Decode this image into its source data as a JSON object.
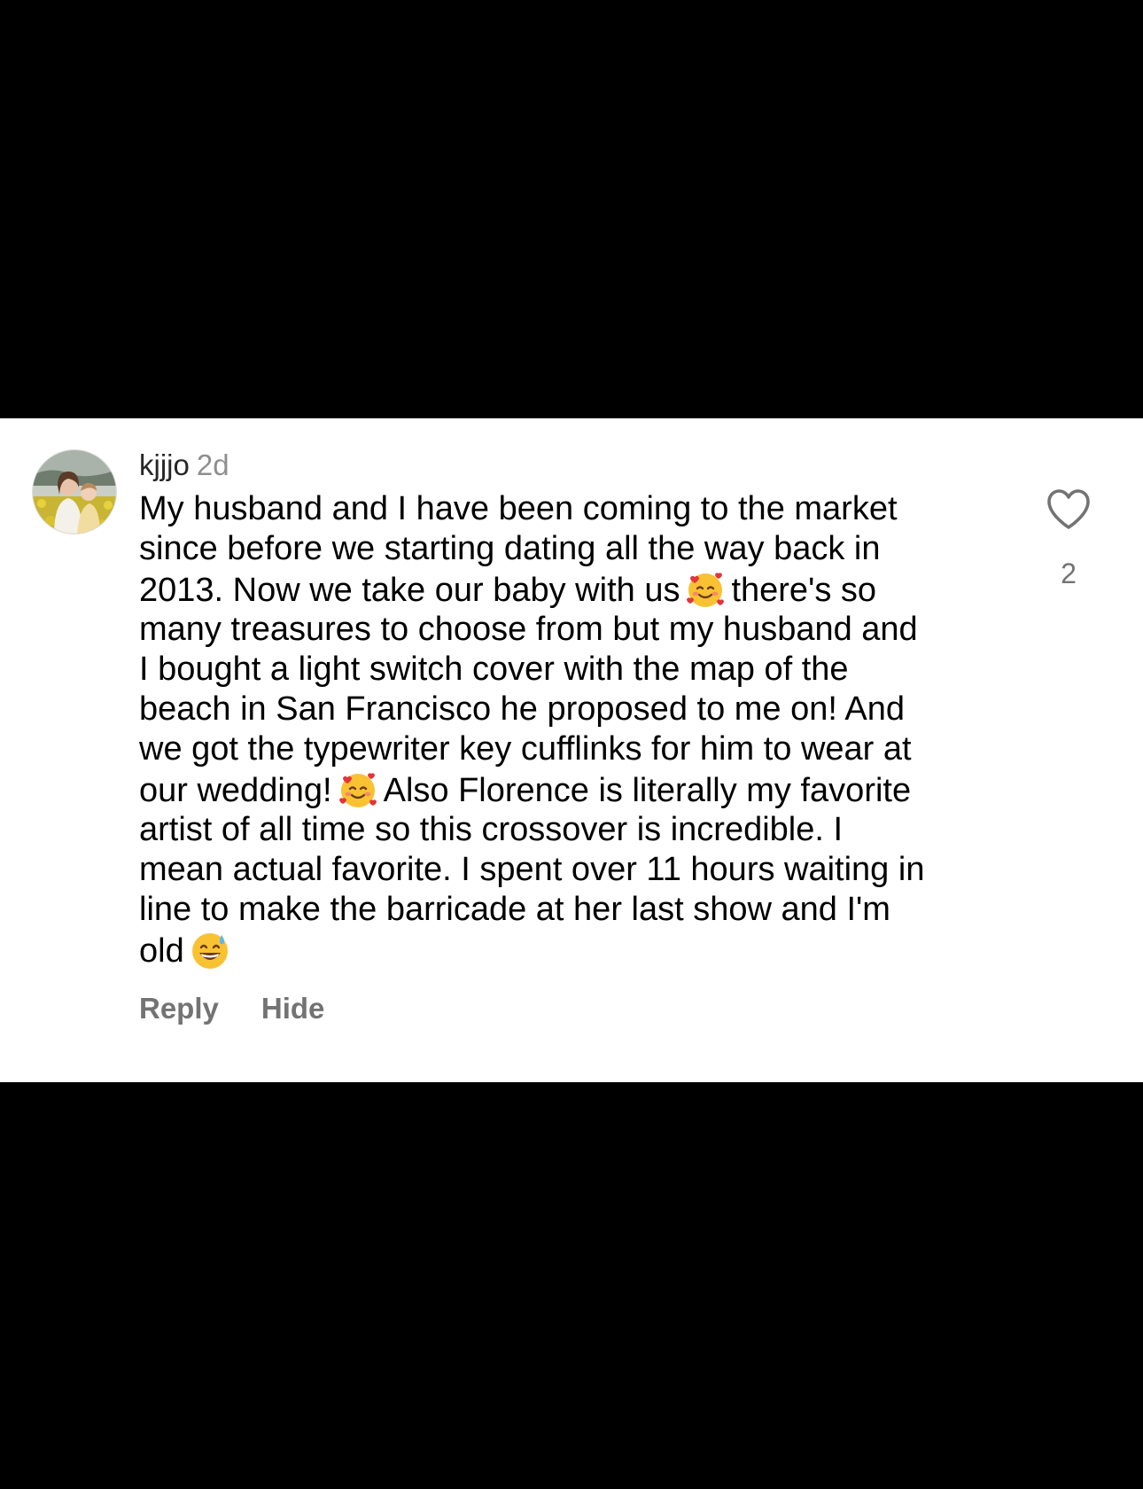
{
  "comment": {
    "username": "kjjjo",
    "timestamp": "2d",
    "avatar_icon": "profile-photo-avatar",
    "body_lines": [
      {
        "segments": [
          "My husband and I have been coming to the market"
        ]
      },
      {
        "segments": [
          "since before we starting dating all the way back in"
        ]
      },
      {
        "segments": [
          "2013. Now we take our baby with us",
          "there's so"
        ],
        "emoji_after_first": "smiling-face-with-hearts"
      },
      {
        "segments": [
          "many treasures to choose from but my husband and"
        ]
      },
      {
        "segments": [
          "I bought a light switch cover with the map of the"
        ]
      },
      {
        "segments": [
          "beach in San Francisco he proposed to me on! And"
        ]
      },
      {
        "segments": [
          "we got the typewriter key cufflinks for him to wear at"
        ]
      },
      {
        "segments": [
          "our wedding!",
          "Also Florence is literally my favorite"
        ],
        "emoji_after_first": "smiling-face-with-hearts"
      },
      {
        "segments": [
          "artist of all time so this crossover is incredible. I"
        ]
      },
      {
        "segments": [
          "mean actual favorite. I spent over 11 hours waiting in"
        ]
      },
      {
        "segments": [
          "line to make the barricade at her last show and I'm"
        ]
      },
      {
        "segments": [
          "old",
          ""
        ],
        "emoji_after_first": "grinning-face-with-sweat"
      }
    ],
    "actions": {
      "reply_label": "Reply",
      "hide_label": "Hide"
    },
    "like": {
      "icon": "heart-outline-icon",
      "count": "2"
    }
  },
  "colors": {
    "background": "#000000",
    "card": "#ffffff",
    "text": "#000000",
    "secondary_text": "#737373"
  }
}
